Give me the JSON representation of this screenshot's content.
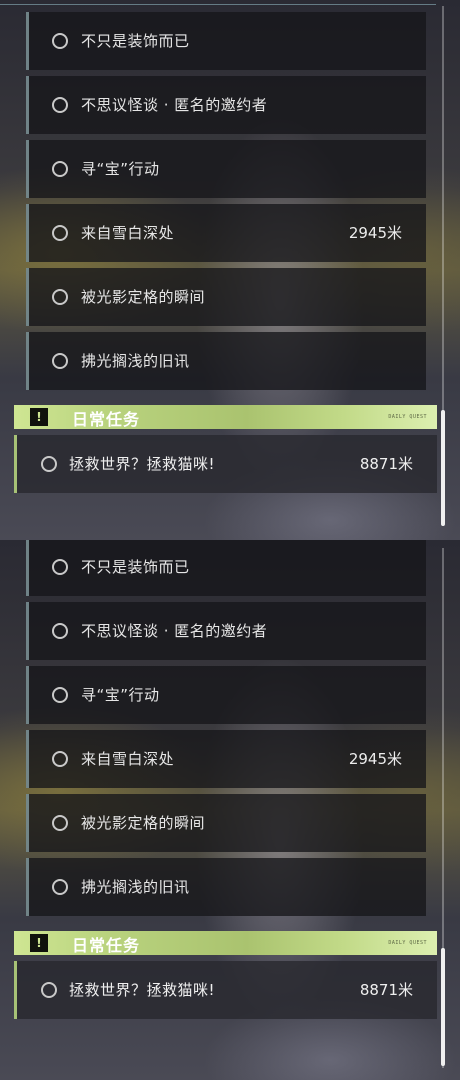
{
  "quests": [
    {
      "title": "不只是装饰而已",
      "distance": ""
    },
    {
      "title": "不思议怪谈 · 匿名的邀约者",
      "distance": ""
    },
    {
      "title": "寻“宝”行动",
      "distance": ""
    },
    {
      "title": "来自雪白深处",
      "distance": "2945米"
    },
    {
      "title": "被光影定格的瞬间",
      "distance": ""
    },
    {
      "title": "拂光搁浅的旧讯",
      "distance": ""
    }
  ],
  "daily_section": {
    "title": "日常任务",
    "icon": "exclamation-flag-icon",
    "decor_text": "DAILY QUEST"
  },
  "daily_quest": {
    "title": "拯救世界？拯救猫咪!",
    "distance": "8871米"
  },
  "colors": {
    "accent": "#c5de8a",
    "quest_bg": "#16161a",
    "text": "#e6e6e6"
  }
}
